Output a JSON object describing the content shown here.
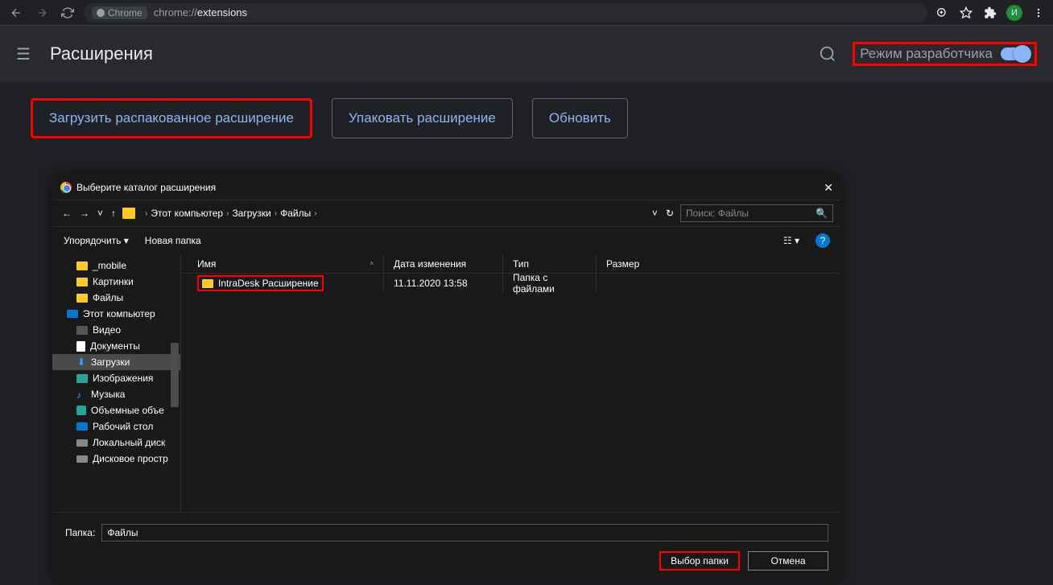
{
  "browser": {
    "address_prefix": "Chrome",
    "address_host": "chrome://",
    "address_path": "extensions",
    "avatar_letter": "И"
  },
  "extensions_page": {
    "title": "Расширения",
    "dev_mode_label": "Режим разработчика",
    "dev_mode_enabled": true,
    "buttons": {
      "load_unpacked": "Загрузить распакованное расширение",
      "pack": "Упаковать расширение",
      "refresh": "Обновить"
    }
  },
  "dialog": {
    "title": "Выберите каталог расширения",
    "breadcrumb": [
      "Этот компьютер",
      "Загрузки",
      "Файлы"
    ],
    "search_placeholder": "Поиск: Файлы",
    "organize": "Упорядочить",
    "new_folder": "Новая папка",
    "tree": [
      {
        "label": "_mobile",
        "icon": "folder",
        "indent": true
      },
      {
        "label": "Картинки",
        "icon": "folder",
        "indent": true
      },
      {
        "label": "Файлы",
        "icon": "folder",
        "indent": true
      },
      {
        "label": "Этот компьютер",
        "icon": "pc",
        "indent": false
      },
      {
        "label": "Видео",
        "icon": "video",
        "indent": true
      },
      {
        "label": "Документы",
        "icon": "doc",
        "indent": true
      },
      {
        "label": "Загрузки",
        "icon": "download",
        "indent": true,
        "selected": true
      },
      {
        "label": "Изображения",
        "icon": "image",
        "indent": true
      },
      {
        "label": "Музыка",
        "icon": "music",
        "indent": true
      },
      {
        "label": "Объемные объе",
        "icon": "3d",
        "indent": true
      },
      {
        "label": "Рабочий стол",
        "icon": "desktop",
        "indent": true
      },
      {
        "label": "Локальный диск",
        "icon": "disk",
        "indent": true
      },
      {
        "label": "Дисковое простр",
        "icon": "disk",
        "indent": true
      }
    ],
    "columns": {
      "name": "Имя",
      "date": "Дата изменения",
      "type": "Тип",
      "size": "Размер"
    },
    "rows": [
      {
        "name": "IntraDesk Расширение",
        "date": "11.11.2020 13:58",
        "type": "Папка с файлами",
        "size": ""
      }
    ],
    "folder_label": "Папка:",
    "folder_value": "Файлы",
    "select_btn": "Выбор папки",
    "cancel_btn": "Отмена"
  }
}
